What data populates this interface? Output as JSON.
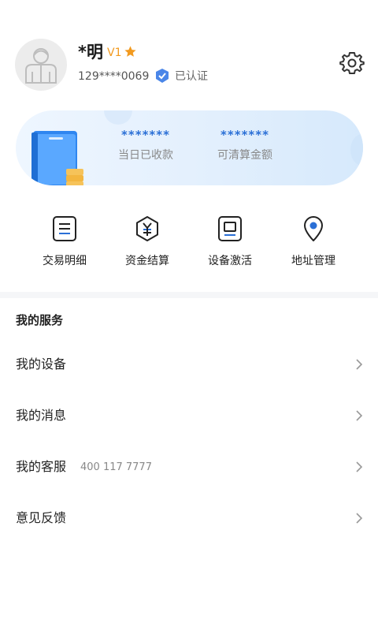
{
  "profile": {
    "name": "*明",
    "level": "V1",
    "phone": "129****0069",
    "verified_label": "已认证"
  },
  "summary": {
    "today_received_value": "*******",
    "today_received_label": "当日已收款",
    "settleable_value": "*******",
    "settleable_label": "可清算金额"
  },
  "quick_actions": [
    {
      "label": "交易明细",
      "icon": "receipt-icon"
    },
    {
      "label": "资金结算",
      "icon": "yuan-hexagon-icon"
    },
    {
      "label": "设备激活",
      "icon": "device-icon"
    },
    {
      "label": "地址管理",
      "icon": "location-pin-icon"
    }
  ],
  "services": {
    "title": "我的服务",
    "items": [
      {
        "label": "我的设备",
        "extra": ""
      },
      {
        "label": "我的消息",
        "extra": ""
      },
      {
        "label": "我的客服",
        "extra": "400 117 7777"
      },
      {
        "label": "意见反馈",
        "extra": ""
      }
    ]
  },
  "colors": {
    "accent": "#2a6fd6",
    "level": "#f29a1f",
    "verified": "#4a86e8"
  }
}
